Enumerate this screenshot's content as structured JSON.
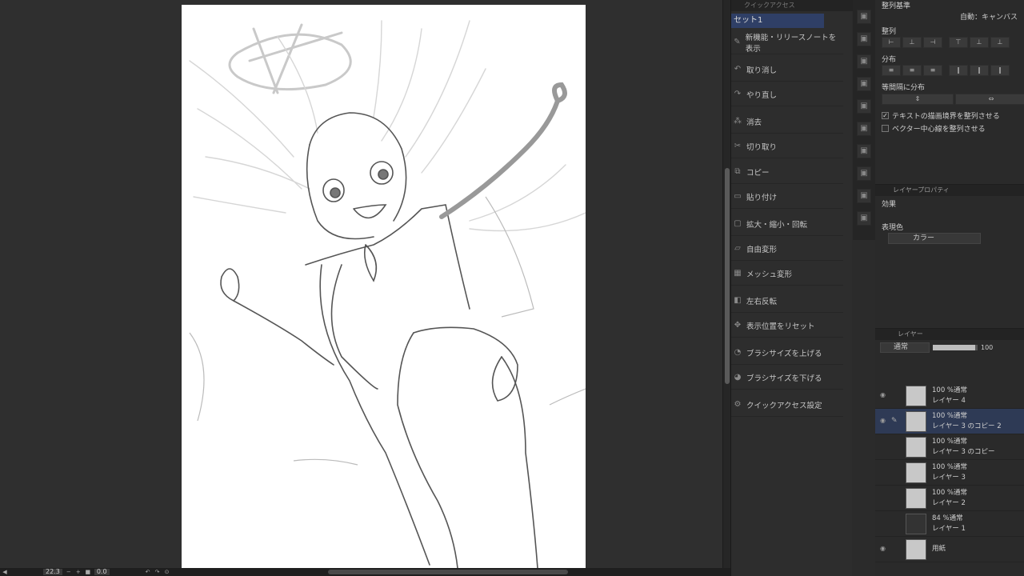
{
  "canvas": {
    "paper_color": "#ffffff"
  },
  "statusbar": {
    "zoom": "22.3",
    "rotation": "0.0"
  },
  "command_panel": {
    "header": "クイックアクセス",
    "selected_set": "セット1",
    "items": [
      {
        "icon": "info-icon",
        "label": "新機能・リリースノートを表示"
      },
      {
        "icon": "undo-icon",
        "label": "取り消し"
      },
      {
        "icon": "redo-icon",
        "label": "やり直し"
      },
      {
        "icon": "clear-icon",
        "label": "消去"
      },
      {
        "icon": "cut-icon",
        "label": "切り取り"
      },
      {
        "icon": "copy-icon",
        "label": "コピー"
      },
      {
        "icon": "paste-icon",
        "label": "貼り付け"
      },
      {
        "icon": "transform-icon",
        "label": "拡大・縮小・回転"
      },
      {
        "icon": "free-transform-icon",
        "label": "自由変形"
      },
      {
        "icon": "mesh-icon",
        "label": "メッシュ変形"
      },
      {
        "icon": "flip-icon",
        "label": "左右反転"
      },
      {
        "icon": "reset-view-icon",
        "label": "表示位置をリセット"
      },
      {
        "icon": "brush-up-icon",
        "label": "ブラシサイズを上げる"
      },
      {
        "icon": "brush-down-icon",
        "label": "ブラシサイズを下げる"
      },
      {
        "icon": "settings-icon",
        "label": "クイックアクセス設定"
      }
    ]
  },
  "align_panel": {
    "basis_label": "整列基準",
    "basis_value": "自動：キャンバス",
    "align_label": "整列",
    "distribute_label": "分布",
    "equal_spacing_label": "等間隔に分布",
    "check_text_label": "テキストの描画境界を整列させる",
    "check_vector_label": "ベクター中心線を整列させる"
  },
  "prop_panel": {
    "header": "レイヤープロパティ",
    "effect_label": "効果",
    "color_label": "表現色",
    "color_value": "カラー"
  },
  "layer_panel": {
    "header": "レイヤー",
    "blend_mode": "通常",
    "opacity": "100",
    "layers": [
      {
        "opacity": "100 %通常",
        "name": "レイヤー 4",
        "visible": true,
        "active": false
      },
      {
        "opacity": "100 %通常",
        "name": "レイヤー 3 のコピー 2",
        "visible": true,
        "active": true
      },
      {
        "opacity": "100 %通常",
        "name": "レイヤー 3 のコピー",
        "visible": false,
        "active": false
      },
      {
        "opacity": "100 %通常",
        "name": "レイヤー 3",
        "visible": false,
        "active": false
      },
      {
        "opacity": "100 %通常",
        "name": "レイヤー 2",
        "visible": false,
        "active": false
      },
      {
        "opacity": "84 %通常",
        "name": "レイヤー 1",
        "visible": false,
        "active": false
      },
      {
        "opacity": "",
        "name": "用紙",
        "visible": true,
        "active": false
      }
    ]
  }
}
